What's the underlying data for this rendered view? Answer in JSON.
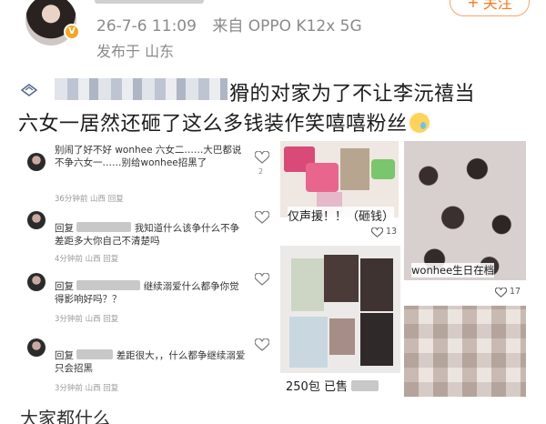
{
  "post": {
    "time": "26-7-6 11:09",
    "source": "来自 OPPO K12x 5G",
    "location": "发布于 山东",
    "follow_label": "关注",
    "text_line1": "猾的对家为了不让李沅禧当",
    "text_line2": "六女一居然还砸了这么多钱装作笑嘻嘻粉丝"
  },
  "comments": [
    {
      "text": "别闹了好不好 wonhee 六女二……大巴都说不争六女一……别给wonhee招黑了",
      "meta": "36分钟前 山西 回复",
      "likes": "2"
    },
    {
      "reply_prefix": "回复",
      "text": "我知道什么该争什么不争差距多大你自己不清楚吗",
      "meta": "4分钟前 山西 回复"
    },
    {
      "reply_prefix": "回复",
      "text": "继续溺爱什么都争你觉得影响好吗？？",
      "meta": "3分钟前 山西 回复"
    },
    {
      "reply_prefix": "回复",
      "text": "差距很大，，什么都争继续溺爱只会招黑",
      "meta": "3分钟前 山西 回复"
    }
  ],
  "images": {
    "card_a_caption": "仅声援！！（砸钱）",
    "card_a_likes": "13",
    "card_b_caption": "wonhee生日在档",
    "card_b_likes": "17",
    "card_c_caption": "250包 已售"
  },
  "footer": {
    "cut_text": "大家都什么"
  },
  "colors": {
    "accent": "#f7791e",
    "meta_gray": "#8a8a8a",
    "text": "#1d1d1d"
  }
}
